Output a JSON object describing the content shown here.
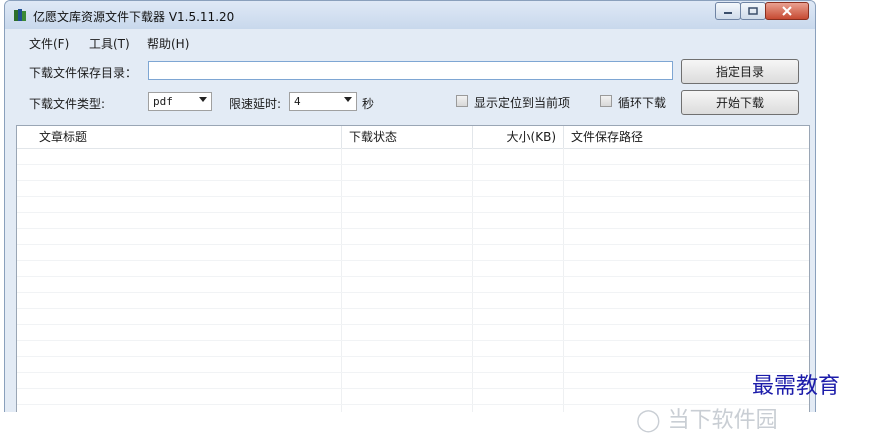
{
  "window": {
    "title": "亿愿文库资源文件下载器 V1.5.11.20"
  },
  "menu": {
    "items": [
      "文件(F)",
      "工具(T)",
      "帮助(H)"
    ]
  },
  "form": {
    "save_dir_label": "下载文件保存目录：",
    "save_dir_value": "",
    "set_dir_button": "指定目录",
    "file_type_label": "下载文件类型:",
    "file_type_value": "pdf",
    "delay_label": "限速延时:",
    "delay_value": "4",
    "delay_unit": "秒",
    "locate_current_label": "显示定位到当前项",
    "locate_current_checked": false,
    "loop_download_label": "循环下载",
    "loop_download_checked": false,
    "start_button": "开始下载"
  },
  "table": {
    "columns": [
      "文章标题",
      "下载状态",
      "大小(KB)",
      "文件保存路径"
    ],
    "rows": []
  },
  "watermark": {
    "text": "最需教育",
    "partial_text": "◯ 当下软件园"
  },
  "colors": {
    "title_bar": "#c8d8ec",
    "window_bg": "#e3ebf5",
    "close_button": "#c74a32",
    "watermark": "#1c1caa"
  }
}
